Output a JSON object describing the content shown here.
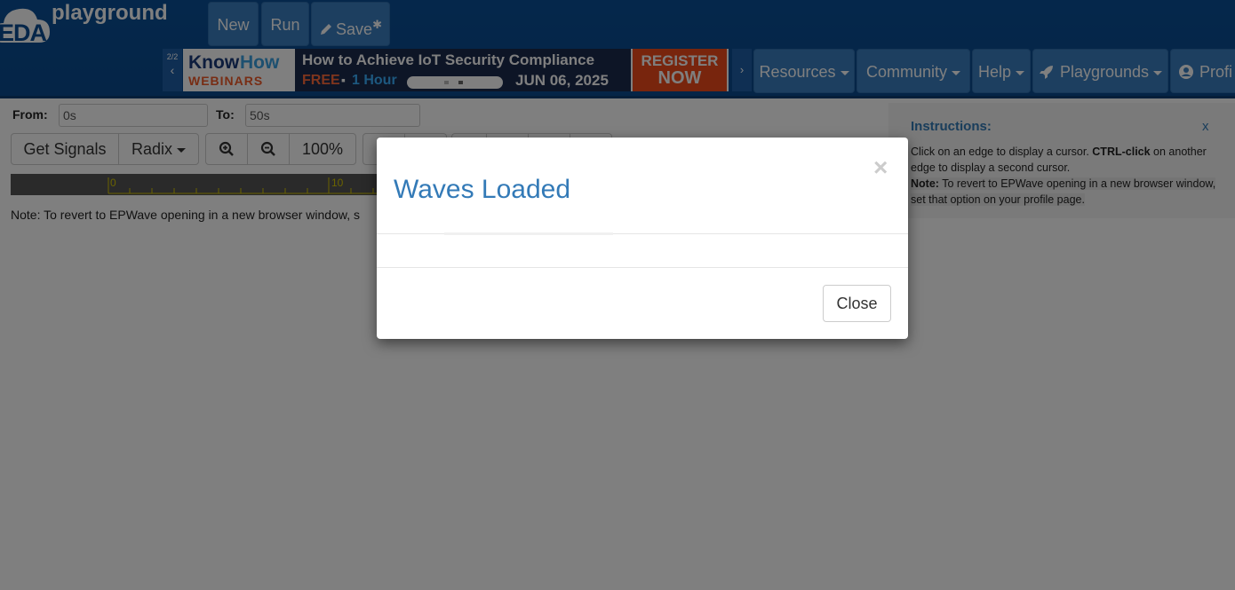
{
  "header": {
    "logo_short": "EDA",
    "logo_text": "playground",
    "buttons": {
      "new": "New",
      "run": "Run",
      "save": "Save",
      "save_marker": "✱"
    },
    "ad": {
      "counter": "2/2",
      "prev": "‹",
      "next": "›",
      "brand1": "Know",
      "brand2": "How",
      "brand_sub": "WEBINARS",
      "headline": "How to Achieve IoT Security Compliance",
      "free": "FREE",
      "bullet": "▪",
      "duration": "1 Hour",
      "date": "JUN 06, 2025",
      "cta1": "REGISTER",
      "cta2": "NOW"
    },
    "nav": {
      "resources": "Resources",
      "community": "Community",
      "help": "Help",
      "playgrounds": "Playgrounds",
      "profile": "Profi"
    }
  },
  "wave_panel": {
    "from_label": "From:",
    "from_value": "0s",
    "to_label": "To:",
    "to_value": "50s",
    "get_signals": "Get Signals",
    "radix": "Radix",
    "zoom_level": "100%",
    "ruler_ticks": [
      "0",
      "10"
    ],
    "note": "Note: To revert to EPWave opening in a new browser window, s"
  },
  "instructions": {
    "title": "Instructions:",
    "close": "x",
    "line1_a": "Click on an edge to display a cursor. ",
    "line1_b": "CTRL-click",
    "line1_c": " on another edge to display a second cursor.",
    "note_label": "Note:",
    "note_text": " To revert to EPWave opening in a new browser window, set that option on your profile page."
  },
  "modal": {
    "title": "Waves Loaded",
    "close_icon": "×",
    "close_button": "Close"
  },
  "colors": {
    "nav_bg": "#0b4f97",
    "nav_button": "#3a7fc1",
    "link_blue": "#337ab7",
    "ad_orange": "#f04a1a",
    "ad_dark": "#1a2a4d"
  }
}
